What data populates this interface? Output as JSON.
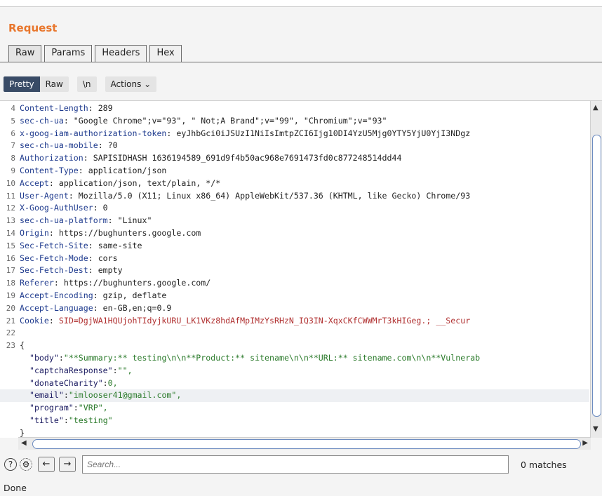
{
  "panel": {
    "title": "Request"
  },
  "tabs": [
    "Raw",
    "Params",
    "Headers",
    "Hex"
  ],
  "toolbar": {
    "pretty": "Pretty",
    "raw": "Raw",
    "newline": "\\n",
    "actions": "Actions"
  },
  "lines": [
    {
      "n": "4",
      "name": "Content-Length",
      "value": " 289"
    },
    {
      "n": "5",
      "name": "sec-ch-ua",
      "value": " \"Google Chrome\";v=\"93\", \" Not;A Brand\";v=\"99\", \"Chromium\";v=\"93\""
    },
    {
      "n": "6",
      "name": "x-goog-iam-authorization-token",
      "value": " eyJhbGci0iJSUzI1NiIsImtpZCI6Ijg10DI4YzU5Mjg0YTY5YjU0YjI3NDgz"
    },
    {
      "n": "7",
      "name": "sec-ch-ua-mobile",
      "value": " ?0"
    },
    {
      "n": "8",
      "name": "Authorization",
      "value": " SAPISIDHASH 1636194589_691d9f4b50ac968e7691473fd0c877248514dd44"
    },
    {
      "n": "9",
      "name": "Content-Type",
      "value": " application/json"
    },
    {
      "n": "10",
      "name": "Accept",
      "value": " application/json, text/plain, */*"
    },
    {
      "n": "11",
      "name": "User-Agent",
      "value": " Mozilla/5.0 (X11; Linux x86_64) AppleWebKit/537.36 (KHTML, like Gecko) Chrome/93"
    },
    {
      "n": "12",
      "name": "X-Goog-AuthUser",
      "value": " 0"
    },
    {
      "n": "13",
      "name": "sec-ch-ua-platform",
      "value": " \"Linux\""
    },
    {
      "n": "14",
      "name": "Origin",
      "value": " https://bughunters.google.com"
    },
    {
      "n": "15",
      "name": "Sec-Fetch-Site",
      "value": " same-site"
    },
    {
      "n": "16",
      "name": "Sec-Fetch-Mode",
      "value": " cors"
    },
    {
      "n": "17",
      "name": "Sec-Fetch-Dest",
      "value": " empty"
    },
    {
      "n": "18",
      "name": "Referer",
      "value": " https://bughunters.google.com/"
    },
    {
      "n": "19",
      "name": "Accept-Encoding",
      "value": " gzip, deflate"
    },
    {
      "n": "20",
      "name": "Accept-Language",
      "value": " en-GB,en;q=0.9"
    }
  ],
  "cookie": {
    "n": "21",
    "name": "Cookie",
    "sid_key": " SID",
    "sid_val": "=DgjWA1HQUjohTIdyjkURU_LK1VKz8hdAfMpIMzYsRHzN_IQ3IN-XqxCKfCWWMrT3kHIGeg.",
    "rest": "; __Secur"
  },
  "blank": {
    "n": "22"
  },
  "body_open": {
    "n": "23",
    "text": "{"
  },
  "json": [
    {
      "k": "\"body\"",
      "v": "\"**Summary:** testing\\n\\n**Product:** sitename\\n\\n**URL:** sitename.com\\n\\n**Vulnerab"
    },
    {
      "k": "\"captchaResponse\"",
      "v": "\"\","
    },
    {
      "k": "\"donateCharity\"",
      "v": "0,"
    },
    {
      "k": "\"email\"",
      "v": "\"imlooser41@gmail.com\","
    },
    {
      "k": "\"program\"",
      "v": "\"VRP\","
    },
    {
      "k": "\"title\"",
      "v": "\"testing\""
    }
  ],
  "body_close": "}",
  "search": {
    "placeholder": "Search...",
    "matches": "0 matches"
  },
  "status": "Done"
}
